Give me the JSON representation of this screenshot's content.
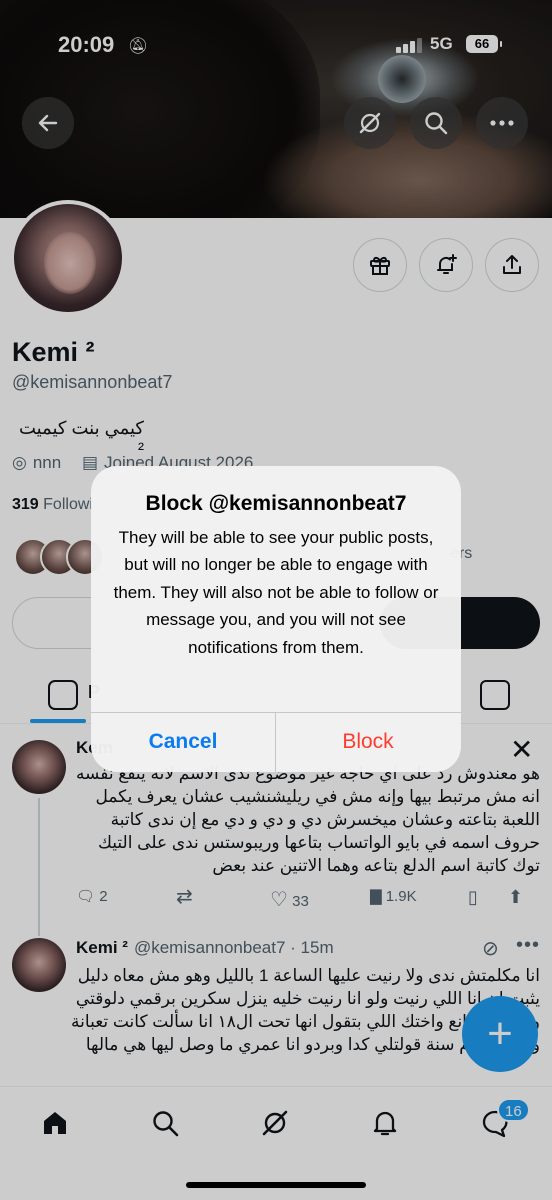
{
  "status_bar": {
    "time": "20:09",
    "network": "5G",
    "battery": "66"
  },
  "profile": {
    "name": "Kemi ²",
    "handle": "@kemisannonbeat7",
    "bio": "كيمي بنت كيميت ²",
    "location": "nnn",
    "joined": "Joined August 2026",
    "following_count": "319",
    "following_label": "Followi",
    "followers_partial": "ers"
  },
  "tabs": {
    "active_label": "P"
  },
  "posts": [
    {
      "author_partial": "Kem",
      "text": "هو معندوش رد على اي حاجة غير موضوع ندى الاسم لانه ينفع نفسه انه مش مرتبط بيها وإنه مش في ريليشنشيب عشان يعرف يكمل اللعبة بتاعته وعشان ميخسرش دي و دي و دي مع إن ندى كاتبة حروف اسمه في بايو الواتساب بتاعها وريبوستس ندى على التيك توك كاتبة اسم الدلع بتاعه وهما الاتنين عند بعض",
      "replies": "2",
      "likes": "33",
      "views": "1.9K"
    },
    {
      "author": "Kemi ²",
      "handle": "@kemisannonbeat7",
      "time": "· 15m",
      "text": "انا مكلمتش ندى ولا رنيت عليها الساعة 1 بالليل وهو مش معاه دليل يثبت ان انا اللي رنيت ولو انا رنيت خليه ينزل سكرين برقمي دلوقتي وعنديش مانع واختك اللي بتقول انها تحت ال١٨ انا سألت كانت تعبانة وسألتك كام سنة قولتلي كدا وبردو انا عمري ما وصل ليها هي مالها"
    }
  ],
  "bottom_nav": {
    "messages_badge": "16"
  },
  "alert": {
    "title": "Block @kemisannonbeat7",
    "message": "They will be able to see your public posts, but will no longer be able to engage with them. They will also not be able to follow or message you, and you will not see notifications from them.",
    "cancel_label": "Cancel",
    "block_label": "Block"
  },
  "colors": {
    "accent": "#1d9bf0",
    "destructive": "#ff3b30",
    "cancel": "#0a7cf0"
  },
  "icons": [
    "back-icon",
    "grok-icon",
    "search-icon",
    "more-icon",
    "gift-icon",
    "bell-plus-icon",
    "share-icon",
    "location-icon",
    "calendar-icon",
    "reply-icon",
    "repost-icon",
    "like-icon",
    "views-icon",
    "bookmark-icon",
    "x-logo-icon",
    "compose-icon",
    "home-icon",
    "notifications-icon",
    "messages-icon"
  ]
}
